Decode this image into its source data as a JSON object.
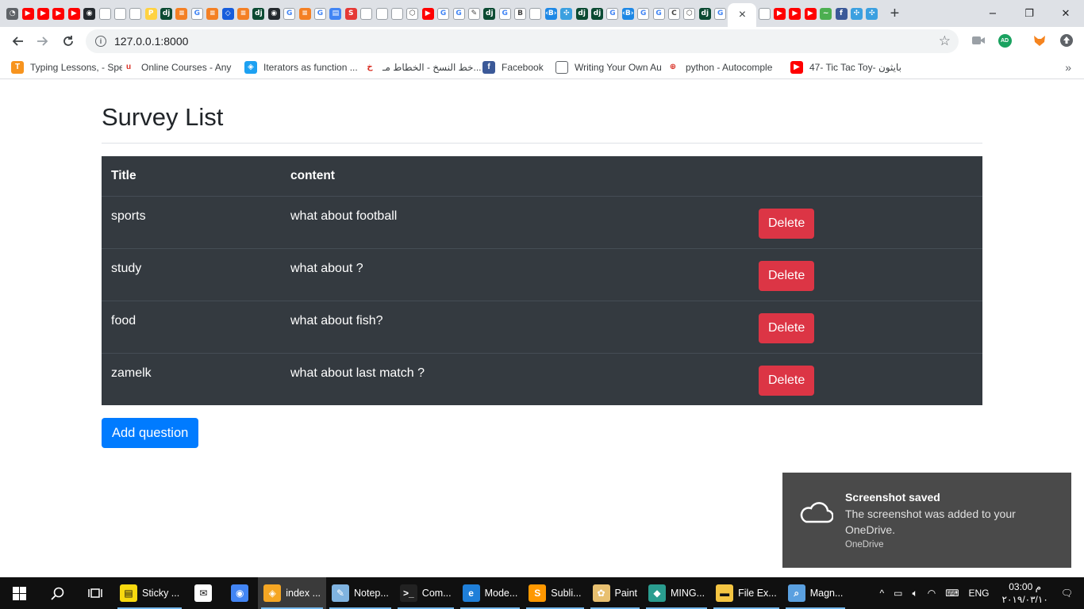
{
  "browser": {
    "address": "127.0.0.1:8000",
    "tab_favicons": [
      "chrome",
      "youtube",
      "youtube",
      "youtube",
      "youtube",
      "github",
      "doc",
      "doc",
      "doc",
      "pypi",
      "django",
      "stackoverflow",
      "google",
      "stackoverflow",
      "bitwarden",
      "stackoverflow",
      "django",
      "github",
      "google",
      "stackoverflow",
      "google",
      "drive",
      "s-red",
      "doc",
      "doc",
      "doc",
      "codepen",
      "youtube",
      "google",
      "google",
      "edit",
      "django",
      "google",
      "bootstrap",
      "doc",
      "bracket",
      "puzzle",
      "django",
      "django",
      "google",
      "bracket",
      "google",
      "google",
      "c",
      "codepen",
      "django",
      "google"
    ],
    "tab_favicons_after": [
      "doc",
      "youtube",
      "youtube",
      "youtube",
      "green",
      "facebook",
      "puzzle",
      "puzzle"
    ],
    "window_controls": [
      "−",
      "❐",
      "✕"
    ],
    "new_tab": "+",
    "close_tab": "×",
    "extensions": {
      "avatar_initials": "AD"
    }
  },
  "bookmarks": [
    {
      "label": "Typing Lessons, - Spe",
      "icon": "typing-icon",
      "color": "#f7941e",
      "glyph": "T"
    },
    {
      "label": "Online Courses - Any",
      "icon": "udemy-icon",
      "color": "#ffffff",
      "glyph": "u"
    },
    {
      "label": "Iterators as function ...",
      "icon": "shield-icon",
      "color": "#1da1f2",
      "glyph": "◈"
    },
    {
      "label": "خط النسخ - الخطاط مـ...",
      "icon": "calligraphy-icon",
      "color": "#ffffff",
      "glyph": "خ"
    },
    {
      "label": "Facebook",
      "icon": "facebook-icon",
      "color": "#3b5998",
      "glyph": "f"
    },
    {
      "label": "Writing Your Own Au",
      "icon": "doc-icon",
      "color": "#ffffff",
      "glyph": ""
    },
    {
      "label": "python - Autocomple",
      "icon": "globe-icon",
      "color": "#ffffff",
      "glyph": "⊕"
    },
    {
      "label": "47- Tic Tac Toy- بايثون",
      "icon": "youtube-icon",
      "color": "#ff0000",
      "glyph": "▶"
    }
  ],
  "page": {
    "title": "Survey List",
    "table": {
      "headers": [
        "Title",
        "content",
        ""
      ],
      "rows": [
        {
          "title": "sports",
          "content": "what about football",
          "action": "Delete"
        },
        {
          "title": "study",
          "content": "what about ?",
          "action": "Delete"
        },
        {
          "title": "food",
          "content": "what about fish?",
          "action": "Delete"
        },
        {
          "title": "zamelk",
          "content": "what about last match ?",
          "action": "Delete"
        }
      ]
    },
    "add_button": "Add question"
  },
  "toast": {
    "title": "Screenshot saved",
    "body": "The screenshot was added to your OneDrive.",
    "source": "OneDrive"
  },
  "taskbar": {
    "apps": [
      {
        "label": "Sticky ...",
        "icon": "sticky-notes-icon",
        "color": "#f8d90f",
        "open": true,
        "active": false
      },
      {
        "label": "",
        "icon": "mail-icon",
        "color": "#ffffff",
        "open": false,
        "active": false
      },
      {
        "label": "",
        "icon": "chrome-icon",
        "color": "#4285f4",
        "open": false,
        "active": false
      },
      {
        "label": "index ...",
        "icon": "browser-icon",
        "color": "#f5a623",
        "open": true,
        "active": true
      },
      {
        "label": "Notep...",
        "icon": "notepad-icon",
        "color": "#7fb3e0",
        "open": true,
        "active": false
      },
      {
        "label": "Com...",
        "icon": "terminal-icon",
        "color": "#222222",
        "open": true,
        "active": false
      },
      {
        "label": "Mode...",
        "icon": "edge-icon",
        "color": "#1f7fd9",
        "open": true,
        "active": false
      },
      {
        "label": "Subli...",
        "icon": "sublime-icon",
        "color": "#ff9800",
        "open": true,
        "active": false
      },
      {
        "label": "Paint",
        "icon": "paint-icon",
        "color": "#e8c070",
        "open": true,
        "active": false
      },
      {
        "label": "MING...",
        "icon": "git-icon",
        "color": "#2a9d8f",
        "open": true,
        "active": false
      },
      {
        "label": "File Ex...",
        "icon": "folder-icon",
        "color": "#f4c542",
        "open": true,
        "active": false
      },
      {
        "label": "Magn...",
        "icon": "magnifier-icon",
        "color": "#5aa0e0",
        "open": true,
        "active": false
      }
    ],
    "tray": {
      "language": "ENG",
      "time": "03:00 م",
      "date": "٢٠١٩/٠٣/١٠"
    }
  }
}
